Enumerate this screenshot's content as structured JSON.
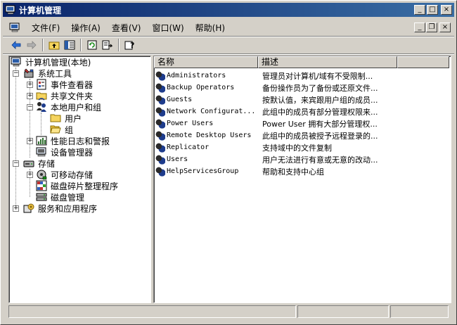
{
  "window": {
    "title": "计算机管理"
  },
  "menu": {
    "items": [
      "文件(F)",
      "操作(A)",
      "查看(V)",
      "窗口(W)",
      "帮助(H)"
    ]
  },
  "caption_buttons": {
    "minimize": "_",
    "maximize": "□",
    "close": "×",
    "mdi_minimize": "_",
    "mdi_restore": "❐",
    "mdi_close": "×"
  },
  "toolbar": {
    "back": "⇦",
    "forward": "⇨",
    "up": "↑",
    "show_hide": "▤",
    "refresh": "↻",
    "export": "⇥",
    "help": "?"
  },
  "tree": {
    "root": "计算机管理(本地)",
    "system_tools": "系统工具",
    "event_viewer": "事件查看器",
    "shared_folders": "共享文件夹",
    "local_users": "本地用户和组",
    "users": "用户",
    "groups": "组",
    "perf_logs": "性能日志和警报",
    "device_manager": "设备管理器",
    "storage": "存储",
    "removable": "可移动存储",
    "defrag": "磁盘碎片整理程序",
    "disk_mgmt": "磁盘管理",
    "services": "服务和应用程序"
  },
  "list": {
    "col_name": "名称",
    "col_desc": "描述",
    "rows": [
      {
        "name": "Administrators",
        "desc": "管理员对计算机/域有不受限制..."
      },
      {
        "name": "Backup Operators",
        "desc": "备份操作员为了备份或还原文件..."
      },
      {
        "name": "Guests",
        "desc": "按默认值，来宾跟用户组的成员..."
      },
      {
        "name": "Network Configurat...",
        "desc": "此组中的成员有部分管理权限来..."
      },
      {
        "name": "Power Users",
        "desc": "Power User 拥有大部分管理权..."
      },
      {
        "name": "Remote Desktop Users",
        "desc": "此组中的成员被授予远程登录的..."
      },
      {
        "name": "Replicator",
        "desc": "支持域中的文件复制"
      },
      {
        "name": "Users",
        "desc": "用户无法进行有意或无意的改动..."
      },
      {
        "name": "HelpServicesGroup",
        "desc": "帮助和支持中心组"
      }
    ]
  },
  "icons": {
    "app": "computer-management-icon",
    "group": "user-group-icon"
  },
  "colors": {
    "titlebar_start": "#0a246a",
    "titlebar_end": "#3a6ea5",
    "face": "#d4d0c8"
  }
}
